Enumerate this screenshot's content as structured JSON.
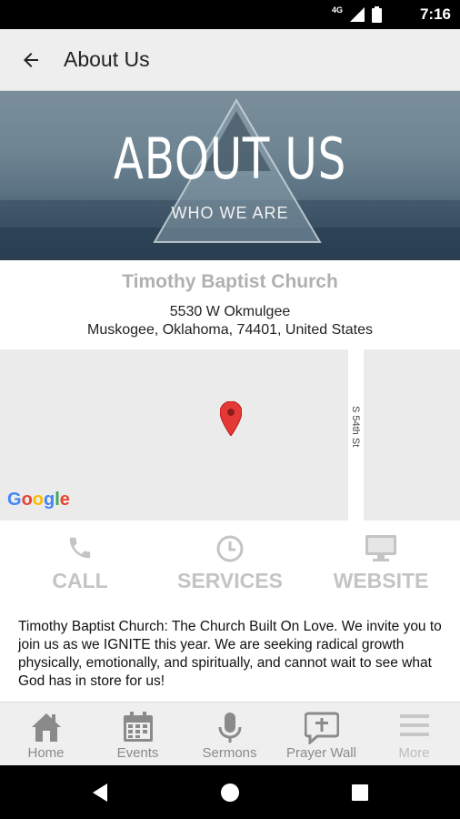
{
  "status_bar": {
    "network": "4G",
    "time": "7:16"
  },
  "app_bar": {
    "title": "About Us",
    "back_icon": "arrow-left-icon"
  },
  "hero": {
    "title": "ABOUT US",
    "subtitle": "WHO WE ARE"
  },
  "church": {
    "name": "Timothy Baptist Church",
    "address_line1": "5530 W Okmulgee",
    "address_line2": "Muskogee, Oklahoma, 74401, United States"
  },
  "map": {
    "street_label": "S 54th St",
    "attribution": [
      "G",
      "o",
      "o",
      "g",
      "l",
      "e"
    ],
    "pin_color": "#e53935"
  },
  "actions": [
    {
      "label": "CALL",
      "icon": "phone-icon"
    },
    {
      "label": "SERVICES",
      "icon": "clock-icon"
    },
    {
      "label": "WEBSITE",
      "icon": "monitor-icon"
    }
  ],
  "description": "Timothy Baptist Church: The Church Built On Love. We invite you to join us as we IGNITE this year. We are seeking radical growth physically, emotionally, and spiritually, and cannot wait to see what God has in store for us!",
  "tabs": [
    {
      "label": "Home",
      "icon": "home-icon"
    },
    {
      "label": "Events",
      "icon": "calendar-icon"
    },
    {
      "label": "Sermons",
      "icon": "microphone-icon"
    },
    {
      "label": "Prayer Wall",
      "icon": "prayer-bubble-icon"
    },
    {
      "label": "More",
      "icon": "menu-icon"
    }
  ],
  "colors": {
    "accent_gray": "#c4c4c4",
    "tab_gray": "#8a8a8a",
    "app_bar": "#eeeeee"
  }
}
